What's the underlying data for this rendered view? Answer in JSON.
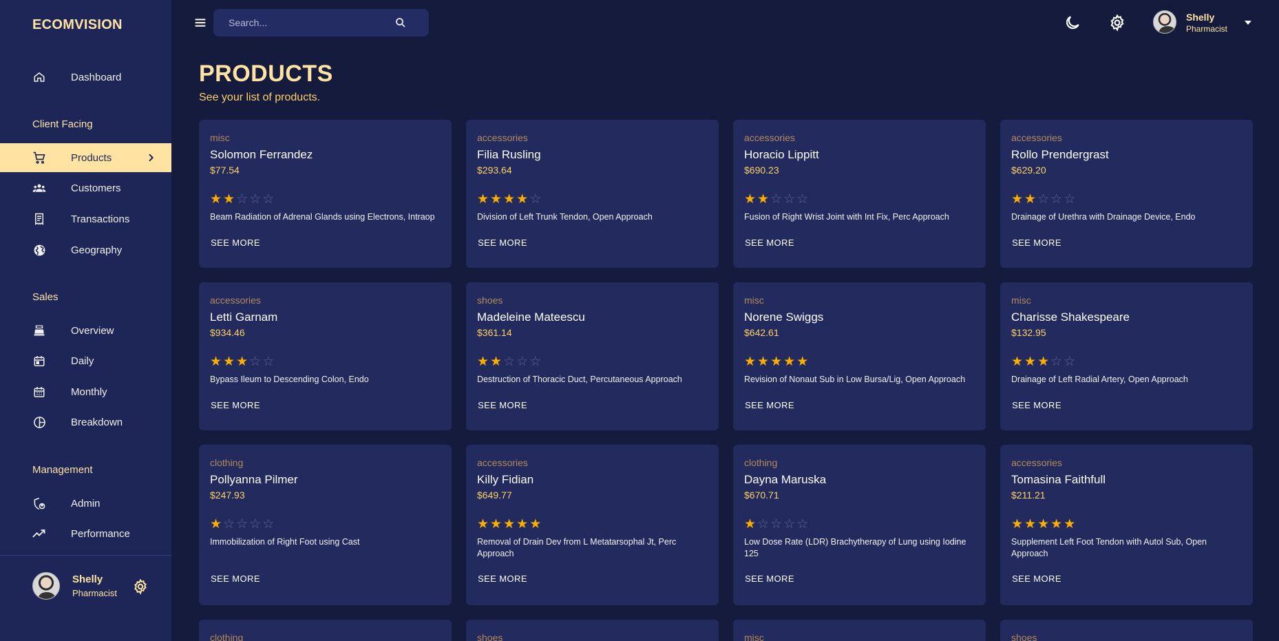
{
  "app": {
    "brand": "ECOMVISION"
  },
  "topbar": {
    "search_placeholder": "Search..."
  },
  "user": {
    "name": "Shelly",
    "role": "Pharmacist"
  },
  "sidebar": {
    "dashboard": "Dashboard",
    "sections": {
      "client": "Client Facing",
      "sales": "Sales",
      "management": "Management"
    },
    "items": {
      "products": "Products",
      "customers": "Customers",
      "transactions": "Transactions",
      "geography": "Geography",
      "overview": "Overview",
      "daily": "Daily",
      "monthly": "Monthly",
      "breakdown": "Breakdown",
      "admin": "Admin",
      "performance": "Performance"
    }
  },
  "page": {
    "title": "PRODUCTS",
    "subtitle": "See your list of products."
  },
  "see_more_label": "SEE MORE",
  "products": [
    {
      "category": "misc",
      "name": "Solomon Ferrandez",
      "price": "$77.54",
      "rating": 2,
      "description": "Beam Radiation of Adrenal Glands using Electrons, Intraop"
    },
    {
      "category": "accessories",
      "name": "Filia Rusling",
      "price": "$293.64",
      "rating": 4,
      "description": "Division of Left Trunk Tendon, Open Approach"
    },
    {
      "category": "accessories",
      "name": "Horacio Lippitt",
      "price": "$690.23",
      "rating": 2,
      "description": "Fusion of Right Wrist Joint with Int Fix, Perc Approach"
    },
    {
      "category": "accessories",
      "name": "Rollo Prendergrast",
      "price": "$629.20",
      "rating": 2,
      "description": "Drainage of Urethra with Drainage Device, Endo"
    },
    {
      "category": "accessories",
      "name": "Letti Garnam",
      "price": "$934.46",
      "rating": 3,
      "description": "Bypass Ileum to Descending Colon, Endo"
    },
    {
      "category": "shoes",
      "name": "Madeleine Mateescu",
      "price": "$361.14",
      "rating": 2,
      "description": "Destruction of Thoracic Duct, Percutaneous Approach"
    },
    {
      "category": "misc",
      "name": "Norene Swiggs",
      "price": "$642.61",
      "rating": 5,
      "description": "Revision of Nonaut Sub in Low Bursa/Lig, Open Approach"
    },
    {
      "category": "misc",
      "name": "Charisse Shakespeare",
      "price": "$132.95",
      "rating": 3,
      "description": "Drainage of Left Radial Artery, Open Approach"
    },
    {
      "category": "clothing",
      "name": "Pollyanna Pilmer",
      "price": "$247.93",
      "rating": 1,
      "description": "Immobilization of Right Foot using Cast"
    },
    {
      "category": "accessories",
      "name": "Killy Fidian",
      "price": "$649.77",
      "rating": 5,
      "description": "Removal of Drain Dev from L Metatarsophal Jt, Perc Approach"
    },
    {
      "category": "clothing",
      "name": "Dayna Maruska",
      "price": "$670.71",
      "rating": 1,
      "description": "Low Dose Rate (LDR) Brachytherapy of Lung using Iodine 125"
    },
    {
      "category": "accessories",
      "name": "Tomasina Faithfull",
      "price": "$211.21",
      "rating": 5,
      "description": "Supplement Left Foot Tendon with Autol Sub, Open Approach"
    },
    {
      "category": "clothing"
    },
    {
      "category": "shoes"
    },
    {
      "category": "misc"
    },
    {
      "category": "shoes"
    }
  ]
}
